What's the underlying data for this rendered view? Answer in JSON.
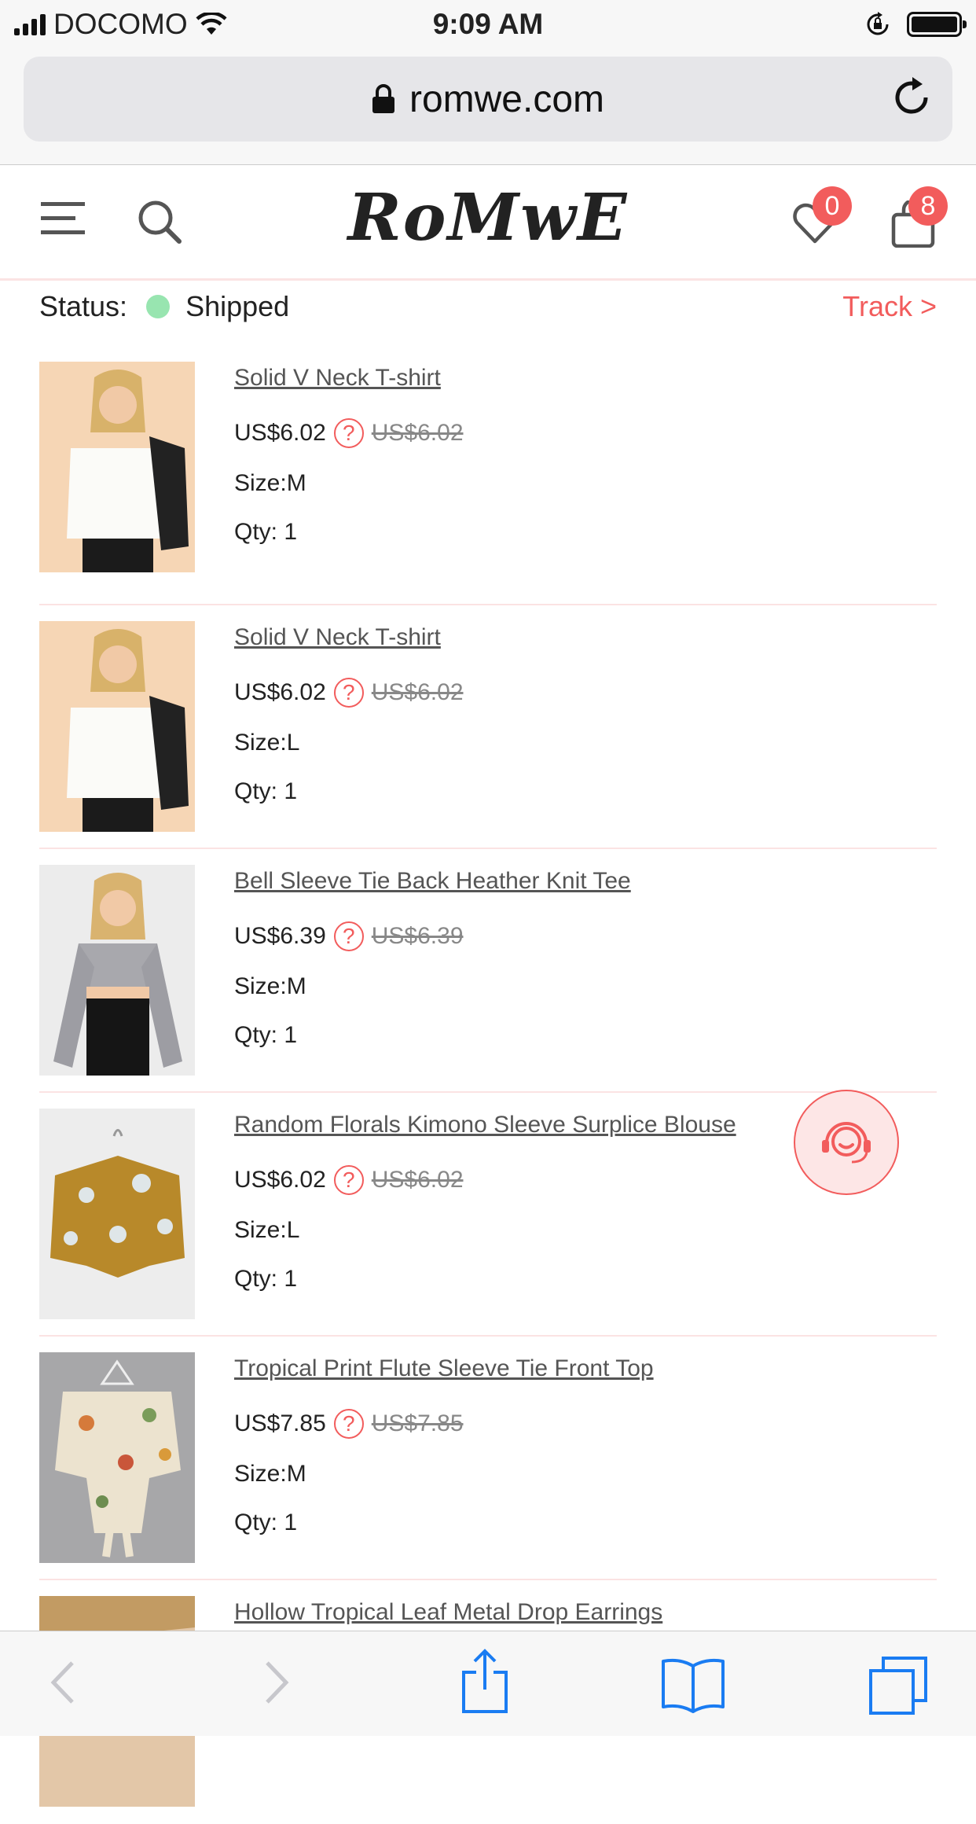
{
  "status_bar": {
    "carrier": "DOCOMO",
    "time": "9:09 AM"
  },
  "browser": {
    "url": "romwe.com"
  },
  "header": {
    "logo": "RoMwE",
    "wishlist_count": "0",
    "cart_count": "8"
  },
  "order": {
    "status_label": "Status:",
    "status_value": "Shipped",
    "track_label": "Track >"
  },
  "items": [
    {
      "name": "Solid V Neck T-shirt",
      "price": "US$6.02",
      "old_price": "US$6.02",
      "size": "Size:M",
      "qty": "Qty: 1"
    },
    {
      "name": "Solid V Neck T-shirt",
      "price": "US$6.02",
      "old_price": "US$6.02",
      "size": "Size:L",
      "qty": "Qty: 1"
    },
    {
      "name": "Bell Sleeve Tie Back Heather Knit Tee",
      "price": "US$6.39",
      "old_price": "US$6.39",
      "size": "Size:M",
      "qty": "Qty: 1"
    },
    {
      "name": "Random Florals Kimono Sleeve Surplice Blouse",
      "price": "US$6.02",
      "old_price": "US$6.02",
      "size": "Size:L",
      "qty": "Qty: 1"
    },
    {
      "name": "Tropical Print Flute Sleeve Tie Front Top",
      "price": "US$7.85",
      "old_price": "US$7.85",
      "size": "Size:M",
      "qty": "Qty: 1"
    },
    {
      "name": "Hollow Tropical Leaf Metal Drop Earrings"
    }
  ],
  "colors": {
    "accent": "#f25c5c",
    "status_dot": "#98e5b0",
    "divider": "#fbe3e3"
  }
}
